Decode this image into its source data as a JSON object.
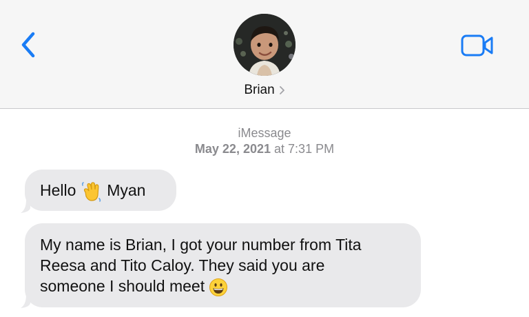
{
  "header": {
    "contact_name": "Brian",
    "back_icon": "chevron-left-icon",
    "video_icon": "video-camera-icon",
    "accent_color": "#1a7cf5"
  },
  "thread": {
    "service": "iMessage",
    "date": "May 22, 2021",
    "time": "7:31 PM",
    "connector": "at"
  },
  "messages": [
    {
      "parts": [
        "Hello",
        "Myan"
      ],
      "emoji": "waving-hand-emoji"
    },
    {
      "lines": [
        "My name is Brian, I got your number from Tita",
        "Reesa and Tito Caloy. They said you are",
        "someone I should meet"
      ],
      "emoji": "grinning-face-emoji"
    }
  ]
}
